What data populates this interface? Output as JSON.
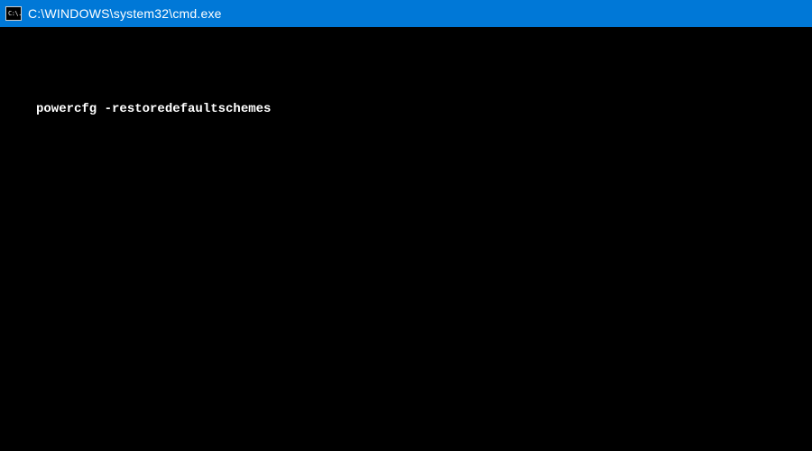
{
  "window": {
    "title": "C:\\WINDOWS\\system32\\cmd.exe",
    "icon_text": "C:\\."
  },
  "terminal": {
    "lines": [
      "powercfg -restoredefaultschemes"
    ]
  }
}
